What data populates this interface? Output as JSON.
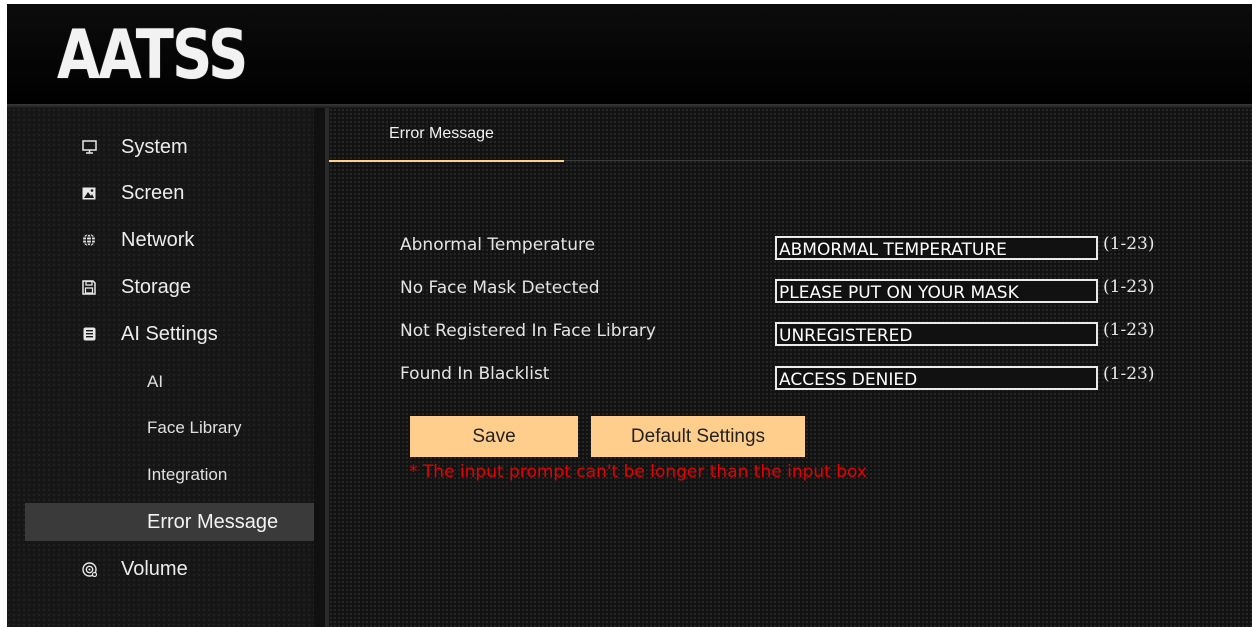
{
  "header": {
    "logo_text": "AATSS"
  },
  "sidebar": {
    "items": [
      {
        "label": "System",
        "icon": "monitor-icon"
      },
      {
        "label": "Screen",
        "icon": "image-icon"
      },
      {
        "label": "Network",
        "icon": "globe-icon"
      },
      {
        "label": "Storage",
        "icon": "floppy-disk-icon"
      },
      {
        "label": "AI Settings",
        "icon": "ai-chip-icon"
      }
    ],
    "ai_sub_items": [
      {
        "label": "AI"
      },
      {
        "label": "Face Library"
      },
      {
        "label": "Integration"
      },
      {
        "label": "Error Message",
        "active": true
      }
    ],
    "volume": {
      "label": "Volume",
      "icon": "speaker-icon"
    }
  },
  "tab": {
    "label": "Error Message"
  },
  "form": {
    "fields": [
      {
        "label": "Abnormal Temperature",
        "value": "ABMORMAL TEMPERATURE",
        "range": "(1-23)"
      },
      {
        "label": "No Face Mask Detected",
        "value": "PLEASE PUT ON YOUR MASK",
        "range": "(1-23)"
      },
      {
        "label": "Not Registered In Face Library",
        "value": "UNREGISTERED",
        "range": "(1-23)"
      },
      {
        "label": "Found In Blacklist",
        "value": "ACCESS DENIED",
        "range": "(1-23)"
      }
    ],
    "save_label": "Save",
    "default_label": "Default Settings",
    "note": "*  The input prompt can't be longer than the input box"
  },
  "colors": {
    "accent": "#ffce8c",
    "note_red": "#e60000",
    "active_item_bg": "#3a3a3a"
  }
}
